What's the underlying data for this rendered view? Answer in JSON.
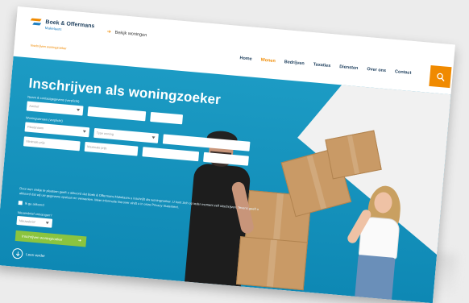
{
  "header": {
    "logo": {
      "name": "Boek & Offermans",
      "sub": "Makelaars"
    },
    "woningen_link": "Bekijk woningen",
    "breadcrumb": "Inschrijven woningzoeker",
    "nav": [
      "Home",
      "Wonen",
      "Bedrijven",
      "Taxaties",
      "Diensten",
      "Over ons",
      "Contact"
    ],
    "nav_active_index": 1,
    "search_icon": "search-icon"
  },
  "hero": {
    "title": "Inschrijven als woningzoeker",
    "labels": {
      "name": "Naam & contactgegevens (verplicht)",
      "wish": "Woningwensen (verplicht)",
      "consent_question": "Nieuwsbrief ontvangen?"
    },
    "fields": {
      "aanhef": "Aanhef",
      "voornaam": "",
      "achternaam": "",
      "tussenvoegsel": "",
      "plaats": "Plaatsnaam",
      "type": "Type woning",
      "prijs": "",
      "minprijs": "Minimale prijs",
      "maxprijs": "Maximale prijs",
      "email": "",
      "telefoon": "",
      "extra": ""
    },
    "consent_text": "Door een vinkje te plaatsen geeft u akkoord dat Boek & Offermans Makelaars u inschrijft als woningzoeker. U kunt zich op ieder moment zelf uitschrijven. Tevens geeft u akkoord dat wij uw gegevens opslaan en verwerken. Meer informatie hierover vindt u in onze Privacy Statement.",
    "checkbox_label": "Ik ga akkoord",
    "newsletter_value": "Nieuwsbrief",
    "submit_label": "Inschrijven woningzoeker",
    "read_more": "Lees verder"
  },
  "colors": {
    "accent": "#f08a00",
    "brand": "#1e7fc1",
    "hero_bg": "#1c9bc4",
    "submit": "#8bc43f"
  }
}
